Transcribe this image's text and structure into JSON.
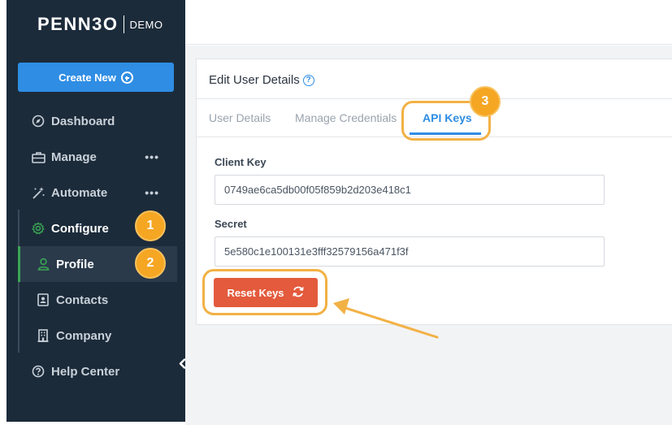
{
  "logo": {
    "word": "PENN3O",
    "demo": "DEMO"
  },
  "sidebar": {
    "create_new_label": "Create New",
    "items": [
      {
        "label": "Dashboard",
        "icon": "compass-icon"
      },
      {
        "label": "Manage",
        "icon": "briefcase-icon",
        "more": "•••"
      },
      {
        "label": "Automate",
        "icon": "magic-wand-icon",
        "more": "•••"
      },
      {
        "label": "Configure",
        "icon": "gear-icon"
      },
      {
        "label": "Profile",
        "icon": "user-icon"
      },
      {
        "label": "Contacts",
        "icon": "contact-card-icon"
      },
      {
        "label": "Company",
        "icon": "building-icon"
      },
      {
        "label": "Help Center",
        "icon": "help-circle-icon"
      }
    ]
  },
  "annotations": {
    "step1": "1",
    "step2": "2",
    "step3": "3",
    "highlight_color": "#f2b145"
  },
  "card": {
    "title": "Edit User Details",
    "help_icon": "?",
    "tabs": [
      "User Details",
      "Manage Credentials",
      "API Keys"
    ],
    "active_tab": "API Keys",
    "client_key_label": "Client Key",
    "client_key_value": "0749ae6ca5db00f05f859b2d203e418c1",
    "secret_label": "Secret",
    "secret_value": "5e580c1e100131e3fff32579156a471f3f",
    "reset_label": "Reset Keys"
  },
  "colors": {
    "sidebar_bg": "#1c2b3a",
    "accent_blue": "#2f8de4",
    "reset_red": "#e35a3c",
    "badge_orange": "#f5a623",
    "active_green": "#3aa655"
  }
}
